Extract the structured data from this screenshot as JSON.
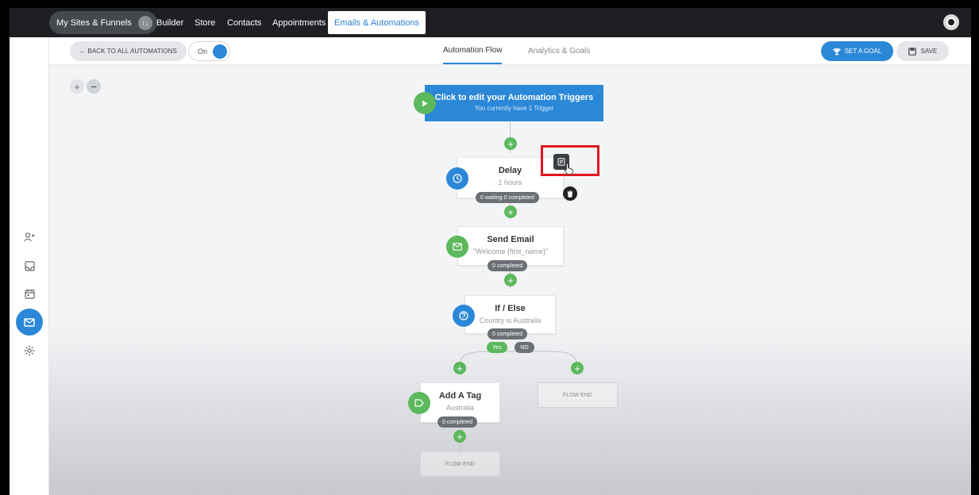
{
  "topnav": {
    "sites_label": "My Sites & Funnels",
    "sites_badge": "↑↓",
    "items": [
      "Builder",
      "Store",
      "Contacts",
      "Appointments"
    ],
    "active_item": "Emails & Automations"
  },
  "subheader": {
    "back_label": "← BACK TO ALL AUTOMATIONS",
    "toggle_label": "On",
    "tabs": [
      "Automation Flow",
      "Analytics & Goals"
    ],
    "goal_label": "SET A GOAL",
    "save_label": "SAVE"
  },
  "canvas": {
    "zoom_in": "+",
    "zoom_out": "−",
    "trigger": {
      "title": "Click to edit your Automation Triggers",
      "subtitle": "You currently have 1 Trigger"
    },
    "nodes": {
      "delay": {
        "title": "Delay",
        "sub": "1 hours",
        "stat": "0 waiting  0 completed"
      },
      "email": {
        "title": "Send Email",
        "sub": "\"Welcome {first_name}\"",
        "stat": "0 completed"
      },
      "ifelse": {
        "title": "If / Else",
        "sub": "Country is Australia",
        "stat": "0 completed",
        "yes": "Yes",
        "no": "NO"
      },
      "tag": {
        "title": "Add A Tag",
        "sub": "Australia",
        "stat": "0 completed"
      }
    },
    "flow_end": "FLOW END",
    "plus": "+"
  },
  "colors": {
    "accent": "#2b88d8",
    "success": "#5cb85c",
    "highlight": "#e0141e"
  }
}
